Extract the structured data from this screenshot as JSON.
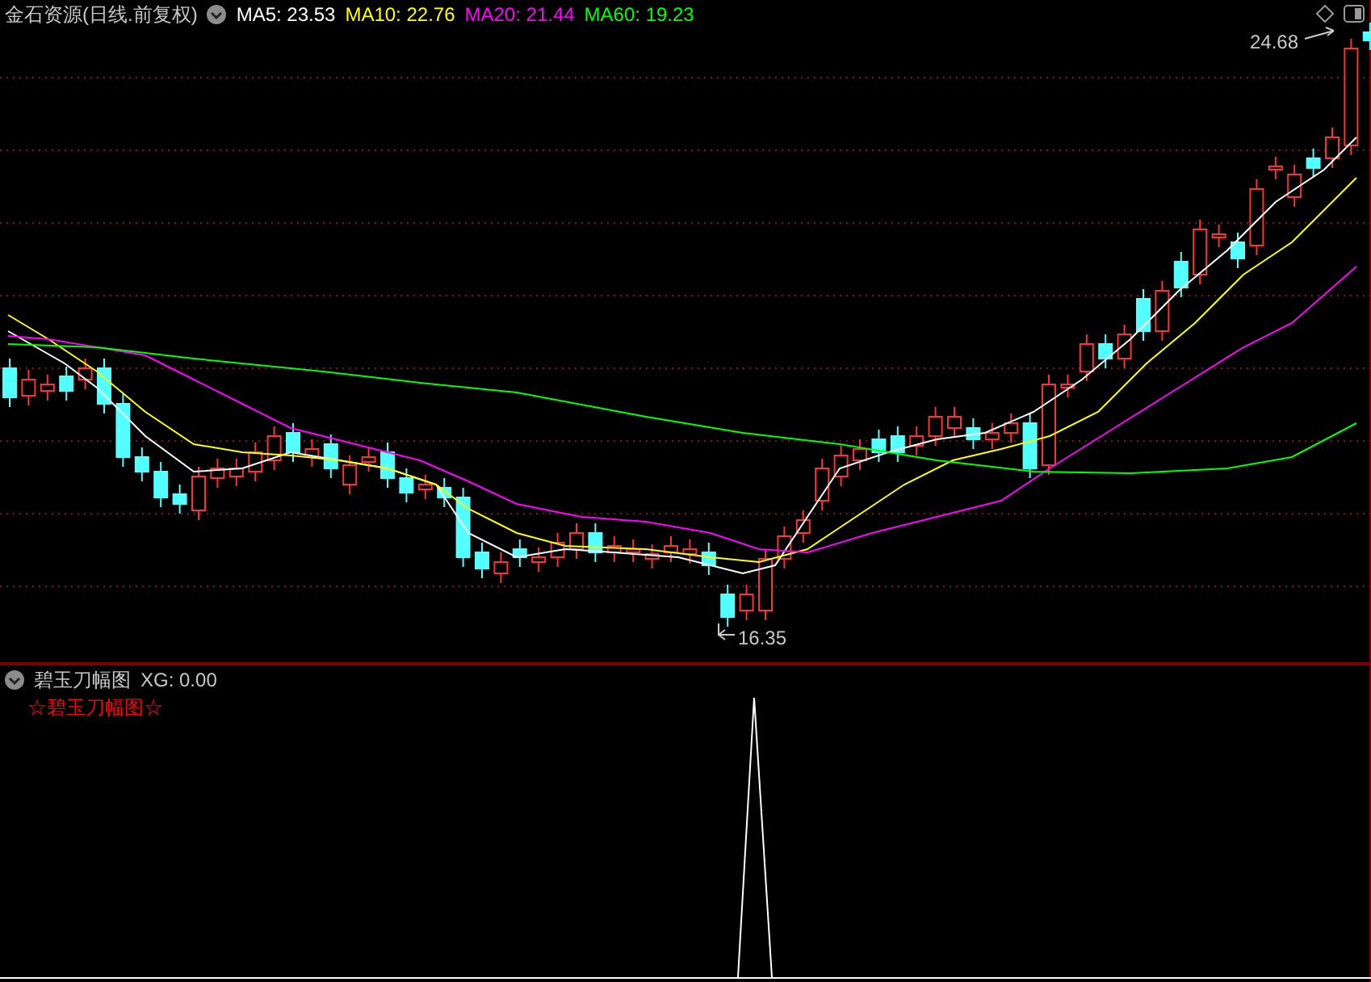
{
  "header": {
    "title": "金石资源(日线.前复权)",
    "indicators": [
      {
        "label": "MA5: 23.53",
        "color": "#ffffff"
      },
      {
        "label": "MA10: 22.76",
        "color": "#ffff00"
      },
      {
        "label": "MA20: 21.44",
        "color": "#ff00ff"
      },
      {
        "label": "MA60: 19.23",
        "color": "#00ff00"
      }
    ]
  },
  "price_labels": {
    "high": "24.68",
    "low": "16.35"
  },
  "sub_panel": {
    "title": "碧玉刀幅图",
    "reading": "XG: 0.00",
    "signal": "☆碧玉刀幅图☆"
  }
}
